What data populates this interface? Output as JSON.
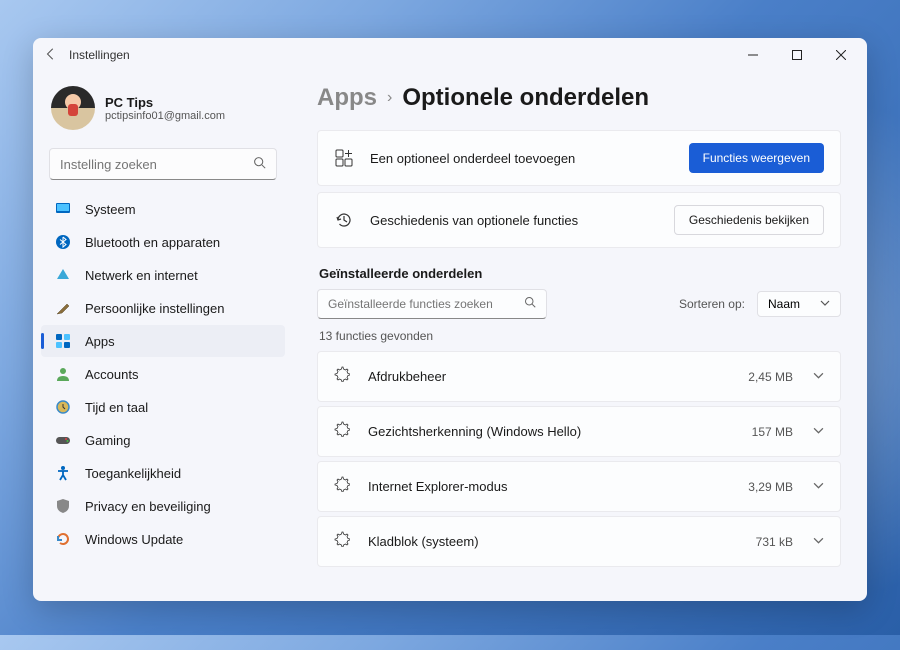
{
  "window": {
    "title": "Instellingen"
  },
  "profile": {
    "name": "PC Tips",
    "email": "pctipsinfo01@gmail.com"
  },
  "search": {
    "placeholder": "Instelling zoeken"
  },
  "nav": {
    "items": [
      {
        "label": "Systeem",
        "icon": "monitor"
      },
      {
        "label": "Bluetooth en apparaten",
        "icon": "bluetooth"
      },
      {
        "label": "Netwerk en internet",
        "icon": "wifi"
      },
      {
        "label": "Persoonlijke instellingen",
        "icon": "brush"
      },
      {
        "label": "Apps",
        "icon": "apps"
      },
      {
        "label": "Accounts",
        "icon": "person"
      },
      {
        "label": "Tijd en taal",
        "icon": "clock"
      },
      {
        "label": "Gaming",
        "icon": "gamepad"
      },
      {
        "label": "Toegankelijkheid",
        "icon": "accessibility"
      },
      {
        "label": "Privacy en beveiliging",
        "icon": "shield"
      },
      {
        "label": "Windows Update",
        "icon": "update"
      }
    ],
    "active_index": 4
  },
  "breadcrumb": {
    "parent": "Apps",
    "current": "Optionele onderdelen"
  },
  "cards": {
    "add": {
      "text": "Een optioneel onderdeel toevoegen",
      "button": "Functies weergeven"
    },
    "history": {
      "text": "Geschiedenis van optionele functies",
      "button": "Geschiedenis bekijken"
    }
  },
  "installed": {
    "title": "Geïnstalleerde onderdelen",
    "search_placeholder": "Geïnstalleerde functies zoeken",
    "sort_label": "Sorteren op:",
    "sort_value": "Naam",
    "count_text": "13 functies gevonden",
    "features": [
      {
        "name": "Afdrukbeheer",
        "size": "2,45 MB"
      },
      {
        "name": "Gezichtsherkenning (Windows Hello)",
        "size": "157 MB"
      },
      {
        "name": "Internet Explorer-modus",
        "size": "3,29 MB"
      },
      {
        "name": "Kladblok (systeem)",
        "size": "731 kB"
      }
    ]
  }
}
